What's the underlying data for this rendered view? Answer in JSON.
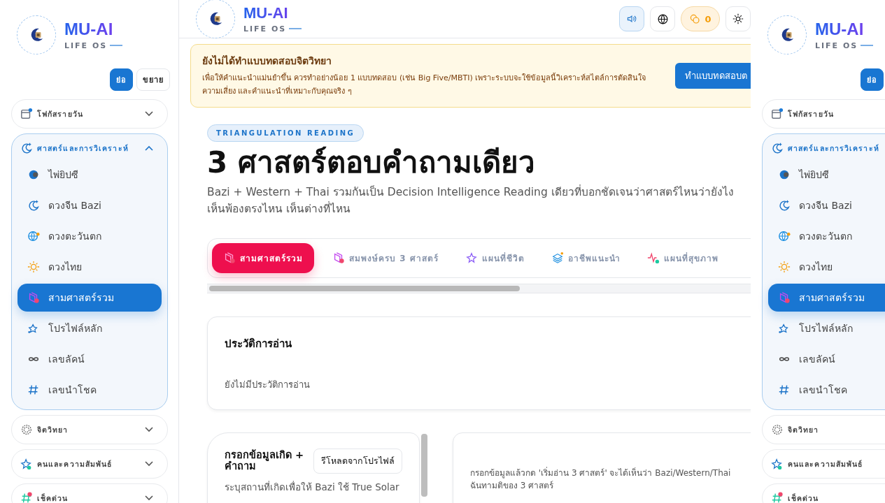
{
  "sidebars": [
    {
      "brand": "MU-AI",
      "tagline": "LIFE OS",
      "collapse_buttons": [
        {
          "label": "ย่อ",
          "selected": true
        },
        {
          "label": "ขยาย",
          "selected": false
        }
      ],
      "groups": [
        {
          "label": "โฟกัสรายวัน",
          "expanded": false
        },
        {
          "label": "ศาสตร์และการวิเคราะห์",
          "expanded": true,
          "items": [
            {
              "label": "ไพ่ยิปซี",
              "selected": false
            },
            {
              "label": "ดวงจีน Bazi",
              "selected": false
            },
            {
              "label": "ดวงตะวันตก",
              "selected": false
            },
            {
              "label": "ดวงไทย",
              "selected": false
            },
            {
              "label": "สามศาสตร์รวม",
              "selected": true
            },
            {
              "label": "โปรไฟล์หลัก",
              "selected": false
            },
            {
              "label": "เลขลัคน์",
              "selected": false
            },
            {
              "label": "เลขนำโชค",
              "selected": false
            }
          ]
        },
        {
          "label": "จิตวิทยา",
          "expanded": false
        },
        {
          "label": "คนและความสัมพันธ์",
          "expanded": false
        },
        {
          "label": "เช็คด่วน",
          "expanded": false
        }
      ]
    },
    {
      "brand": "MU-AI",
      "tagline": "LIFE OS",
      "collapse_buttons": [
        {
          "label": "ย่อ",
          "selected": true
        }
      ],
      "groups": [
        {
          "label": "โฟกัสรายวัน",
          "expanded": false
        },
        {
          "label": "ศาสตร์และการวิเคราะห์",
          "expanded": true,
          "items": [
            {
              "label": "ไพ่ยิปซี",
              "selected": false
            },
            {
              "label": "ดวงจีน Bazi",
              "selected": false
            },
            {
              "label": "ดวงตะวันตก",
              "selected": false
            },
            {
              "label": "ดวงไทย",
              "selected": false
            },
            {
              "label": "สามศาสตร์รวม",
              "selected": true
            },
            {
              "label": "โปรไฟล์หลัก",
              "selected": false
            },
            {
              "label": "เลขลัคน์",
              "selected": false
            },
            {
              "label": "เลขนำโชค",
              "selected": false
            }
          ]
        },
        {
          "label": "จิตวิทยา",
          "expanded": false
        },
        {
          "label": "คนและความสัมพันธ์",
          "expanded": false
        },
        {
          "label": "เช็คด่วน",
          "expanded": false
        }
      ]
    }
  ],
  "header": {
    "brand": "MU-AI",
    "tagline": "LIFE OS",
    "toolbar": [
      {
        "kind": "sound",
        "on": true
      },
      {
        "kind": "language",
        "on": false
      },
      {
        "kind": "coins",
        "on": false,
        "label": "0"
      },
      {
        "kind": "theme",
        "on": false
      }
    ]
  },
  "banner": {
    "title": "ยังไม่ได้ทำแบบทดสอบจิตวิทยา",
    "text": "เพื่อให้คำแนะนำแม่นยำขึ้น ควรทำอย่างน้อย 1 แบบทดสอบ (เช่น Big Five/MBTI) เพราะระบบจะใช้ข้อมูลนี้วิเคราะห์สไตล์การตัดสินใจ ความเสี่ยง และคำแนะนำที่เหมาะกับคุณจริง ๆ",
    "button": "ทำแบบทดสอบต"
  },
  "hero": {
    "eyebrow": "TRIANGULATION READING",
    "title": "3 ศาสตร์ตอบคำถามเดียว",
    "subtitle": "Bazi + Western + Thai รวมกันเป็น Decision Intelligence Reading เดียวที่บอกชัดเจนว่าศาสตร์ไหนว่ายังไง เห็นพ้องตรงไหน เห็นต่างที่ไหน"
  },
  "tabs": [
    {
      "label": "สามศาสตร์รวม",
      "selected": true
    },
    {
      "label": "สมพงษ์ครบ 3 ศาสตร์",
      "selected": false
    },
    {
      "label": "แผนที่ชีวิต",
      "selected": false
    },
    {
      "label": "อาชีพแนะนำ",
      "selected": false
    },
    {
      "label": "แผนที่สุขภาพ",
      "selected": false
    }
  ],
  "history": {
    "title": "ประวัติการอ่าน",
    "empty": "ยังไม่มีประวัติการอ่าน"
  },
  "form": {
    "title": "กรอกข้อมูลเกิด + คำถาม",
    "button": "รีโหลดจากโปรไฟล์",
    "hint": "ระบุสถานที่เกิดเพื่อให้ Bazi ใช้ True Solar"
  },
  "result": {
    "text": "กรอกข้อมูลแล้วกด 'เริ่มอ่าน 3 ศาสตร์' จะได้เห็นว่า Bazi/Western/Thai",
    "text_2": "ฉันทามติของ 3 ศาสตร์"
  }
}
